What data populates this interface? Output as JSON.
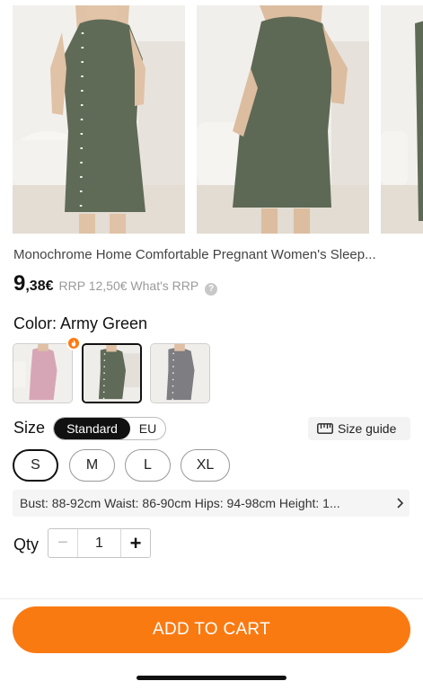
{
  "product": {
    "title": "Monochrome Home Comfortable Pregnant Women's Sleep...",
    "price_int": "9",
    "price_dec": ",38€",
    "rrp_text": "RRP 12,50€ What's RRP",
    "rrp_help_icon": "?"
  },
  "gallery": {
    "icons": [
      "dress-front-photo",
      "dress-back-photo",
      "dress-partial-photo"
    ]
  },
  "color": {
    "label": "Color: Army Green",
    "swatches": [
      {
        "name": "pink",
        "color": "#d7a6b6"
      },
      {
        "name": "army-green",
        "color": "#5f6b58",
        "selected": true
      },
      {
        "name": "grey",
        "color": "#7d7d82"
      }
    ],
    "badge_color": "#ff7a0f"
  },
  "size": {
    "label": "Size",
    "toggle": {
      "standard": "Standard",
      "eu": "EU"
    },
    "guide": "Size guide",
    "options": [
      "S",
      "M",
      "L",
      "XL"
    ],
    "selected": "S",
    "measurements": "Bust: 88-92cm Waist: 86-90cm Hips: 94-98cm Height: 1..."
  },
  "qty": {
    "label": "Qty",
    "value": "1",
    "minus": "−",
    "plus": "+"
  },
  "cta": {
    "label": "ADD TO CART",
    "color": "#fa7a12"
  }
}
